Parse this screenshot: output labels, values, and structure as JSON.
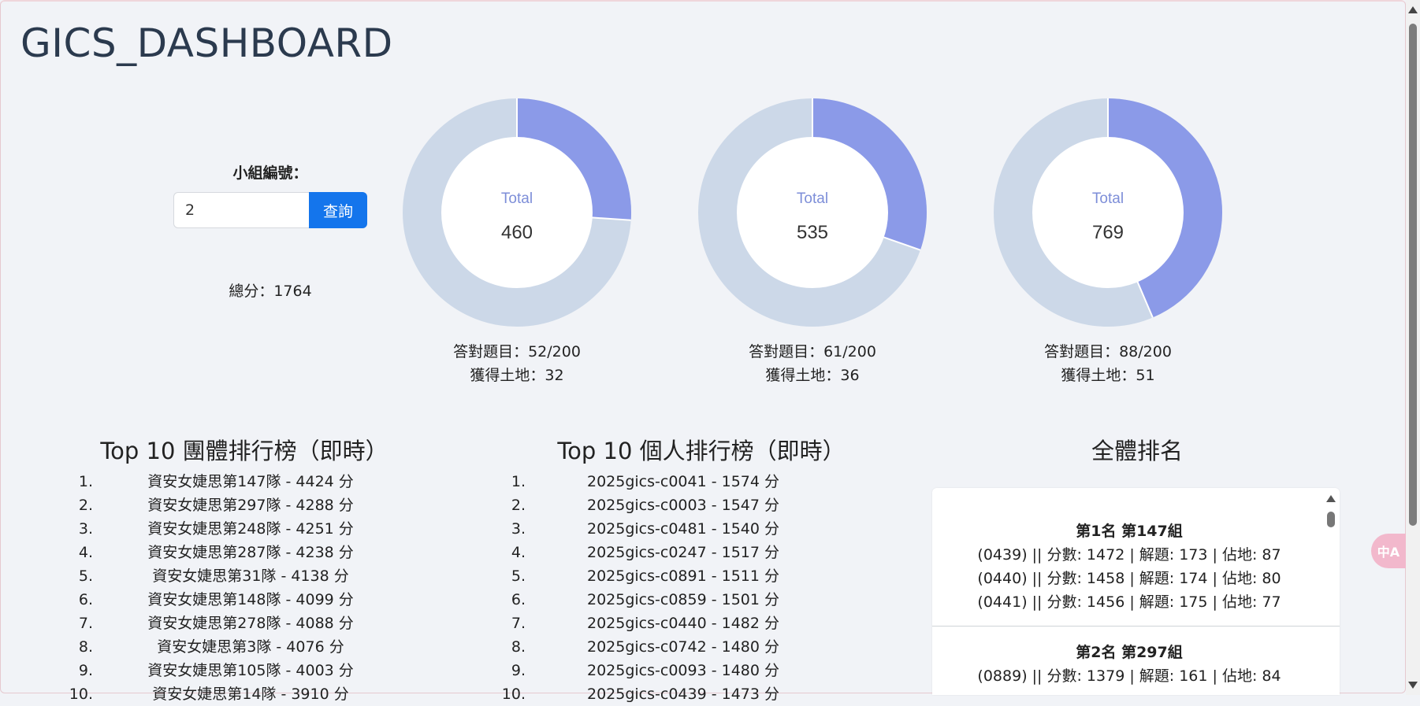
{
  "header": {
    "title": "GICS_DASHBOARD"
  },
  "query": {
    "label": "小組編號：",
    "input_value": "2",
    "button_label": "查詢",
    "total_score": "總分：1764"
  },
  "donuts": [
    {
      "label": "Total",
      "total": 460,
      "correct": 52,
      "out_of": 200,
      "correct_text": "答對題目：52/200",
      "land_text": "獲得土地：32"
    },
    {
      "label": "Total",
      "total": 535,
      "correct": 61,
      "out_of": 200,
      "correct_text": "答對題目：61/200",
      "land_text": "獲得土地：36"
    },
    {
      "label": "Total",
      "total": 769,
      "correct": 88,
      "out_of": 200,
      "correct_text": "答對題目：88/200",
      "land_text": "獲得土地：51"
    }
  ],
  "colors": {
    "donut_filled": "#8b9ae8",
    "donut_empty": "#ccd8e8",
    "donut_label": "#7d8ed8",
    "button": "#1475ec"
  },
  "team_ranking": {
    "title": "Top 10 團體排行榜（即時）",
    "items": [
      {
        "rank": "1.",
        "text": "資安女婕思第147隊 - 4424 分"
      },
      {
        "rank": "2.",
        "text": "資安女婕思第297隊 - 4288 分"
      },
      {
        "rank": "3.",
        "text": "資安女婕思第248隊 - 4251 分"
      },
      {
        "rank": "4.",
        "text": "資安女婕思第287隊 - 4238 分"
      },
      {
        "rank": "5.",
        "text": "資安女婕思第31隊 - 4138 分"
      },
      {
        "rank": "6.",
        "text": "資安女婕思第148隊 - 4099 分"
      },
      {
        "rank": "7.",
        "text": "資安女婕思第278隊 - 4088 分"
      },
      {
        "rank": "8.",
        "text": "資安女婕思第3隊 - 4076 分"
      },
      {
        "rank": "9.",
        "text": "資安女婕思第105隊 - 4003 分"
      },
      {
        "rank": "10.",
        "text": "資安女婕思第14隊 - 3910 分"
      }
    ]
  },
  "individual_ranking": {
    "title": "Top 10 個人排行榜（即時）",
    "items": [
      {
        "rank": "1.",
        "text": "2025gics-c0041 - 1574 分"
      },
      {
        "rank": "2.",
        "text": "2025gics-c0003 - 1547 分"
      },
      {
        "rank": "3.",
        "text": "2025gics-c0481 - 1540 分"
      },
      {
        "rank": "4.",
        "text": "2025gics-c0247 - 1517 分"
      },
      {
        "rank": "5.",
        "text": "2025gics-c0891 - 1511 分"
      },
      {
        "rank": "6.",
        "text": "2025gics-c0859 - 1501 分"
      },
      {
        "rank": "7.",
        "text": "2025gics-c0440 - 1482 分"
      },
      {
        "rank": "8.",
        "text": "2025gics-c0742 - 1480 分"
      },
      {
        "rank": "9.",
        "text": "2025gics-c0093 - 1480 分"
      },
      {
        "rank": "10.",
        "text": "2025gics-c0439 - 1473 分"
      }
    ]
  },
  "overall_ranking": {
    "title": "全體排名",
    "groups": [
      {
        "heading": "第1名 第147組",
        "lines": [
          "(0439) || 分數: 1472 | 解題: 173 | 佔地: 87",
          "(0440) || 分數: 1458 | 解題: 174 | 佔地: 80",
          "(0441) || 分數: 1456 | 解題: 175 | 佔地: 77"
        ]
      },
      {
        "heading": "第2名 第297組",
        "lines": [
          "(0889) || 分數: 1379 | 解題: 161 | 佔地: 84"
        ]
      }
    ]
  },
  "translate_widget": {
    "label": "中A"
  }
}
